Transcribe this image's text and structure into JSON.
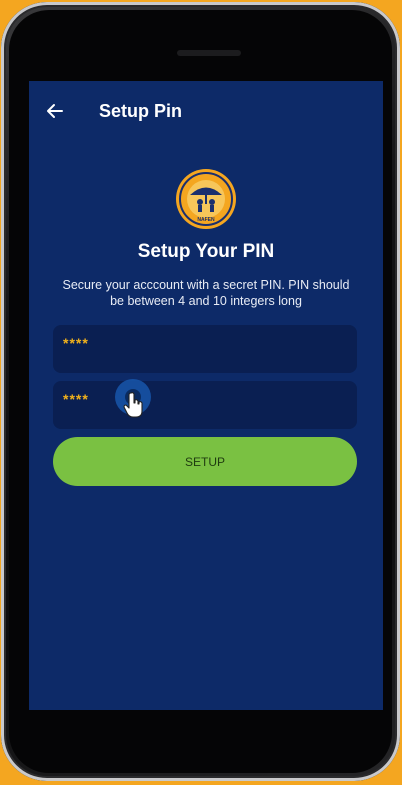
{
  "appbar": {
    "title": "Setup Pin"
  },
  "logo": {
    "icon": "org-logo-badge",
    "text": "NAFEN"
  },
  "main": {
    "heading": "Setup Your PIN",
    "description": "Secure your acccount with a secret PIN. PIN should be between 4 and 10 integers long"
  },
  "form": {
    "pin_value": "****",
    "confirm_pin_value": "****",
    "submit_label": "SETUP"
  },
  "colors": {
    "background": "#f4a620",
    "screen": "#0d2a68",
    "field": "#0a1f52",
    "button": "#7ac142",
    "masked_text": "#f2b21c"
  },
  "icons": [
    "back-arrow-icon",
    "hand-pointer-icon"
  ]
}
